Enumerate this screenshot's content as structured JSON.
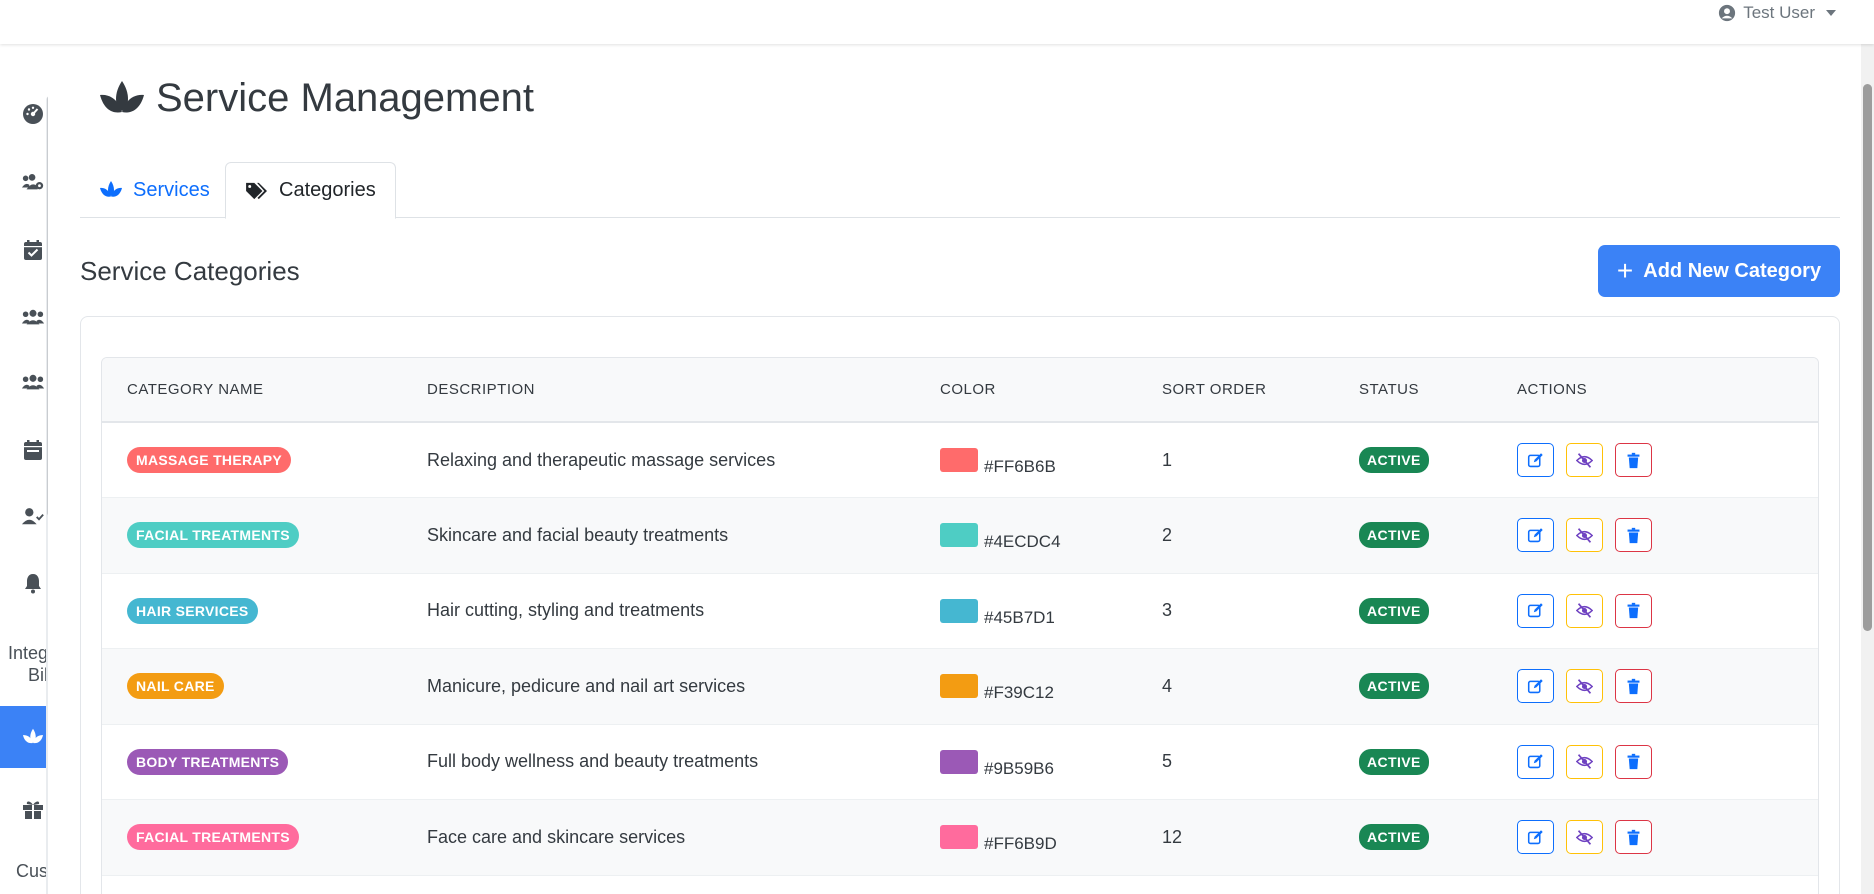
{
  "header": {
    "user_name": "Test User",
    "user_icon": "user-circle-icon",
    "caret_icon": "caret-down-icon"
  },
  "sidebar": {
    "items": [
      {
        "icon": "dashboard-gauge-icon"
      },
      {
        "icon": "users-cog-icon"
      },
      {
        "icon": "calendar-check-icon"
      },
      {
        "icon": "users-icon"
      },
      {
        "icon": "users-group-icon"
      },
      {
        "icon": "calendar-icon"
      },
      {
        "icon": "user-check-icon"
      },
      {
        "icon": "bell-icon"
      },
      {
        "label_line1": "Integ",
        "label_line2": "Bil"
      },
      {
        "icon": "spa-icon",
        "active": true
      },
      {
        "icon": "gift-icon"
      },
      {
        "label_partial": "Cus"
      }
    ]
  },
  "page": {
    "title": "Service Management",
    "title_icon": "spa-icon",
    "tabs": [
      {
        "label": "Services",
        "icon": "spa-icon",
        "active": false
      },
      {
        "label": "Categories",
        "icon": "tags-icon",
        "active": true
      }
    ],
    "section_title": "Service Categories",
    "add_button_label": "Add New Category"
  },
  "table": {
    "headers": [
      "CATEGORY NAME",
      "DESCRIPTION",
      "COLOR",
      "SORT ORDER",
      "STATUS",
      "ACTIONS"
    ],
    "rows": [
      {
        "name": "MASSAGE THERAPY",
        "description": "Relaxing and therapeutic massage services",
        "color": "#FF6B6B",
        "sort_order": "1",
        "status": "ACTIVE"
      },
      {
        "name": "FACIAL TREATMENTS",
        "description": "Skincare and facial beauty treatments",
        "color": "#4ECDC4",
        "sort_order": "2",
        "status": "ACTIVE"
      },
      {
        "name": "HAIR SERVICES",
        "description": "Hair cutting, styling and treatments",
        "color": "#45B7D1",
        "sort_order": "3",
        "status": "ACTIVE"
      },
      {
        "name": "NAIL CARE",
        "description": "Manicure, pedicure and nail art services",
        "color": "#F39C12",
        "sort_order": "4",
        "status": "ACTIVE"
      },
      {
        "name": "BODY TREATMENTS",
        "description": "Full body wellness and beauty treatments",
        "color": "#9B59B6",
        "sort_order": "5",
        "status": "ACTIVE"
      },
      {
        "name": "FACIAL TREATMENTS",
        "description": "Face care and skincare services",
        "color": "#FF6B9D",
        "sort_order": "12",
        "status": "ACTIVE"
      }
    ]
  },
  "colors": {
    "primary": "#3B82F6",
    "link": "#0D6EFD",
    "success": "#198754",
    "warning": "#FFC107",
    "danger": "#DC3545"
  }
}
